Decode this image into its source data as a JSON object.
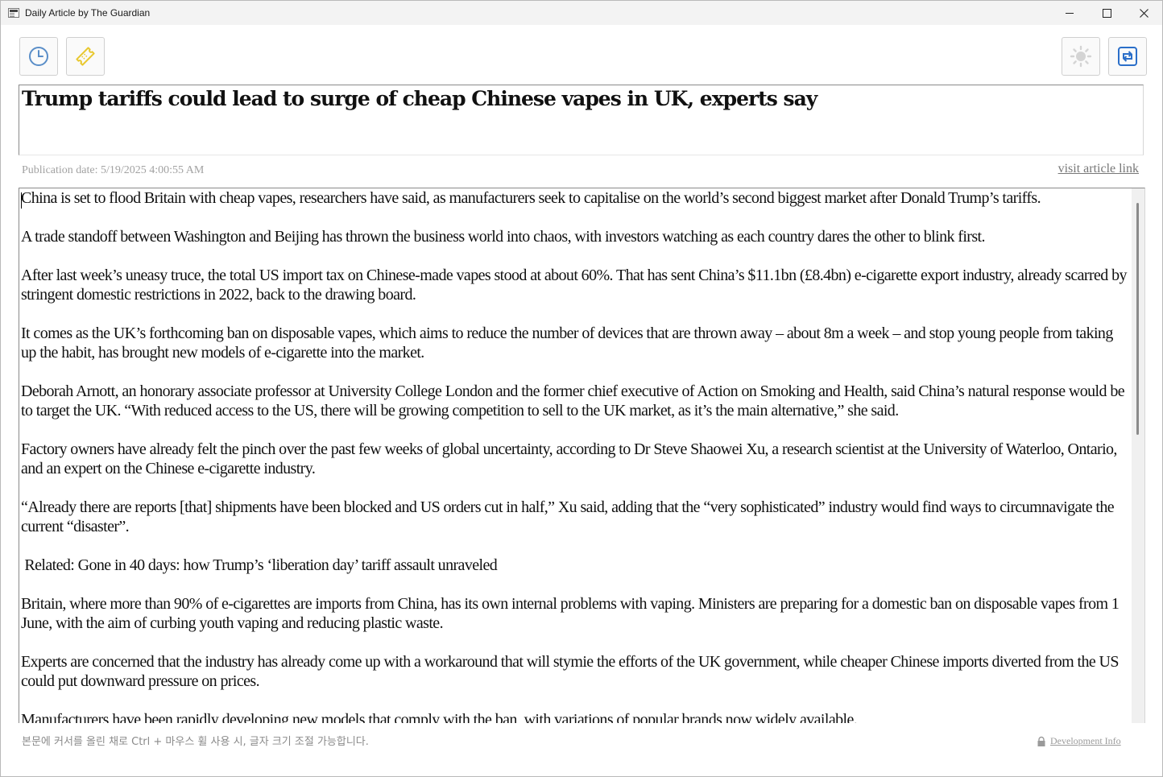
{
  "window": {
    "title": "Daily Article by The Guardian"
  },
  "toolbar": {
    "history_icon": "clock-icon",
    "random_icon": "ticket-icon",
    "theme_icon": "sun-icon",
    "refresh_icon": "refresh-icon"
  },
  "article": {
    "headline": "Trump tariffs could lead to surge of cheap Chinese vapes in UK, experts say",
    "publication_date": "Publication date: 5/19/2025 4:00:55 AM",
    "link_label": "visit article link",
    "paragraphs": [
      "China is set to flood Britain with cheap vapes, researchers have said, as manufacturers seek to capitalise on the world’s second biggest market after Donald Trump’s tariffs.",
      "A trade standoff between Washington and Beijing has thrown the business world into chaos, with investors watching as each country dares the other to blink first.",
      "After last week’s uneasy truce, the total US import tax on Chinese-made vapes stood at about 60%. That has sent China’s $11.1bn (£8.4bn) e-cigarette export industry, already scarred by stringent domestic restrictions in 2022, back to the drawing board.",
      "It comes as the UK’s forthcoming ban on disposable vapes, which aims to reduce the number of devices that are thrown away – about 8m a week – and stop young people from taking up the habit, has brought new models of e-cigarette into the market.",
      "Deborah Arnott, an honorary associate professor at University College London and the former chief executive of Action on Smoking and Health, said China’s natural response would be to target the UK. “With reduced access to the US, there will be growing competition to sell to the UK market, as it’s the main alternative,” she said.",
      "Factory owners have already felt the pinch over the past few weeks of global uncertainty, according to Dr Steve Shaowei Xu, a research scientist at the University of Waterloo, Ontario, and an expert on the Chinese e-cigarette industry.",
      "“Already there are reports [that] shipments have been blocked and US orders cut in half,” Xu said, adding that the “very sophisticated” industry would find ways to circumnavigate the current “disaster”.",
      " Related: Gone in 40 days: how Trump’s ‘liberation day’ tariff assault unraveled",
      "Britain, where more than 90% of e-cigarettes are imports from China, has its own internal problems with vaping. Ministers are preparing for a domestic ban on disposable vapes from 1 June, with the aim of curbing youth vaping and reducing plastic waste.",
      "Experts are concerned that the industry has already come up with a workaround that will stymie the efforts of the UK government, while cheaper Chinese imports diverted from the US could put downward pressure on prices.",
      "Manufacturers have been rapidly developing new models that comply with the ban, with variations of popular brands now widely available."
    ]
  },
  "footer": {
    "hint": "본문에 커서를 올린 채로 Ctrl + 마우스 휠 사용 시, 글자 크기 조절 가능합니다.",
    "dev_info": "Development Info"
  },
  "colors": {
    "random_icon": "#e8c830",
    "history_icon": "#5a8ec8",
    "refresh_icon": "#2b6fc9",
    "theme_icon": "#d4d4d4"
  }
}
